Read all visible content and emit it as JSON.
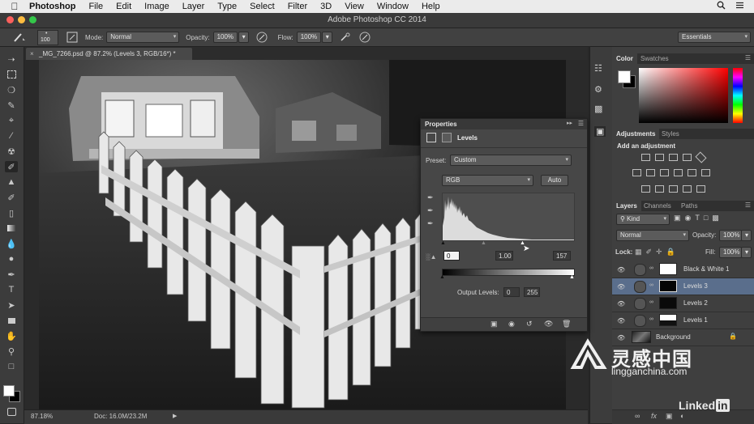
{
  "menubar": {
    "apple_icon": "apple-icon",
    "items": [
      "Photoshop",
      "File",
      "Edit",
      "Image",
      "Layer",
      "Type",
      "Select",
      "Filter",
      "3D",
      "View",
      "Window",
      "Help"
    ]
  },
  "window": {
    "title": "Adobe Photoshop CC 2014"
  },
  "options": {
    "brush_size": "100",
    "mode_label": "Mode:",
    "mode_value": "Normal",
    "opacity_label": "Opacity:",
    "opacity_value": "100%",
    "flow_label": "Flow:",
    "flow_value": "100%",
    "workspace": "Essentials"
  },
  "document": {
    "tab_title": "_MG_7266.psd @ 87.2% (Levels 3, RGB/16*) *",
    "zoom": "87.18%",
    "doc_size": "Doc: 16.0M/23.2M"
  },
  "color_panel": {
    "tabs": [
      "Color",
      "Swatches"
    ],
    "foreground": "#ffffff",
    "background": "#000000",
    "picker_hue": "#ff0000"
  },
  "adjustments_panel": {
    "tabs": [
      "Adjustments",
      "Styles"
    ],
    "heading": "Add an adjustment"
  },
  "layers_panel": {
    "tabs": [
      "Layers",
      "Channels",
      "Paths"
    ],
    "filter_kind": "Kind",
    "blend_mode": "Normal",
    "opacity_label": "Opacity:",
    "opacity_value": "100%",
    "lock_label": "Lock:",
    "fill_label": "Fill:",
    "fill_value": "100%",
    "layers": [
      {
        "name": "Black & White 1",
        "selected": false
      },
      {
        "name": "Levels 3",
        "selected": true
      },
      {
        "name": "Levels 2",
        "selected": false
      },
      {
        "name": "Levels 1",
        "selected": false
      },
      {
        "name": "Background",
        "selected": false
      }
    ]
  },
  "properties_panel": {
    "title": "Properties",
    "adjustment_name": "Levels",
    "preset_label": "Preset:",
    "preset_value": "Custom",
    "channel": "RGB",
    "auto_button": "Auto",
    "input_black": "0",
    "input_gamma": "1.00",
    "input_white": "157",
    "output_label": "Output Levels:",
    "output_black": "0",
    "output_white": "255"
  },
  "watermarks": {
    "brand_cn": "灵感中国",
    "brand_url": "lingganchina.com",
    "linkedin": "Linked",
    "linkedin_in": "in"
  }
}
